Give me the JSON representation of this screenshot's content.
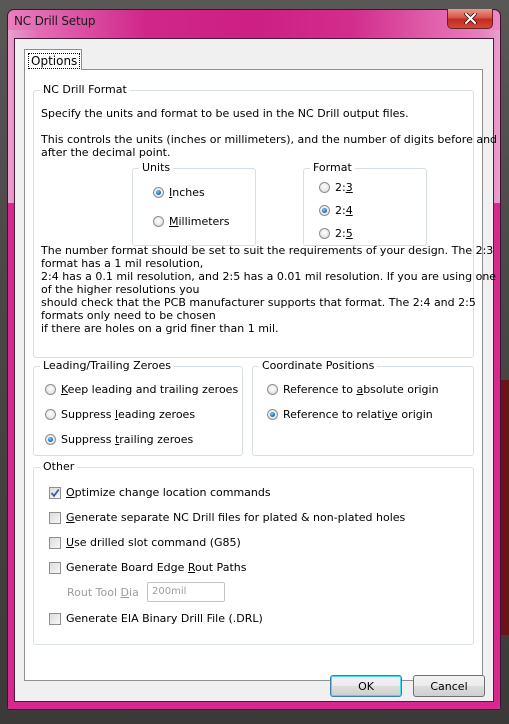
{
  "window": {
    "title": "NC Drill Setup",
    "close_icon": "close-icon"
  },
  "tabs": [
    {
      "label": "Options",
      "selected": true
    }
  ],
  "nc_drill_format": {
    "label": "NC Drill Format",
    "description_1": "Specify the units and format to be used in the NC Drill output files.",
    "description_2_line1": "This controls the units (inches or millimeters), and the number of digits before and",
    "description_2_line2": "after the decimal point.",
    "units": {
      "label": "Units",
      "options": [
        {
          "label_pre": "",
          "accel": "I",
          "label_post": "nches",
          "selected": true
        },
        {
          "label_pre": "",
          "accel": "M",
          "label_post": "illimeters",
          "selected": false
        }
      ]
    },
    "format": {
      "label": "Format",
      "options": [
        {
          "label_pre": "2:",
          "accel": "3",
          "label_post": "",
          "selected": false
        },
        {
          "label_pre": "2:",
          "accel": "4",
          "label_post": "",
          "selected": true
        },
        {
          "label_pre": "2:",
          "accel": "5",
          "label_post": "",
          "selected": false
        }
      ]
    },
    "note_lines": [
      "The number format should be set to suit the requirements of your design. The 2:3",
      "format has a 1 mil resolution,",
      "2:4 has a 0.1 mil resolution, and 2:5 has a 0.01 mil resolution. If you are using one",
      "of the higher resolutions you",
      "should check that the PCB manufacturer supports that format. The 2:4 and 2:5",
      "formats only need to be chosen",
      "if there are holes on a grid finer than 1 mil."
    ]
  },
  "zeroes": {
    "label": "Leading/Trailing Zeroes",
    "options": [
      {
        "label_pre": "",
        "accel": "K",
        "label_post": "eep leading and trailing zeroes",
        "selected": false
      },
      {
        "label_pre": "Suppress ",
        "accel": "l",
        "label_post": "eading zeroes",
        "selected": false
      },
      {
        "label_pre": "Suppress ",
        "accel": "t",
        "label_post": "railing zeroes",
        "selected": true
      }
    ]
  },
  "coordinates": {
    "label": "Coordinate Positions",
    "options": [
      {
        "label_pre": "Reference to ",
        "accel": "a",
        "label_post": "bsolute origin",
        "selected": false
      },
      {
        "label_pre": "Reference to relati",
        "accel": "v",
        "label_post": "e origin",
        "selected": true
      }
    ]
  },
  "other": {
    "label": "Other",
    "options": [
      {
        "label_pre": "",
        "accel": "O",
        "label_post": "ptimize change location commands",
        "checked": true
      },
      {
        "label_pre": "",
        "accel": "G",
        "label_post": "enerate separate NC Drill files for plated & non-plated holes",
        "checked": false
      },
      {
        "label_pre": "",
        "accel": "U",
        "label_post": "se drilled slot command (G85)",
        "checked": false
      },
      {
        "label_pre": "Generate Board Edge ",
        "accel": "R",
        "label_post": "out Paths",
        "checked": false
      },
      {
        "label_pre": "Generate EIA Binary Drill File (.DRL)",
        "accel": "",
        "label_post": "",
        "checked": false
      }
    ],
    "rout_tool_dia": {
      "label_pre": "Rout Tool ",
      "accel": "D",
      "label_post": "ia",
      "value": "200mil",
      "enabled": false
    }
  },
  "buttons": {
    "ok": "OK",
    "cancel": "Cancel"
  },
  "colors": {
    "frame_accent": "#d0268a",
    "close_button": "#c12a20",
    "radio_selected": "#1a79c2",
    "default_button_border": "#3c7fb1"
  }
}
